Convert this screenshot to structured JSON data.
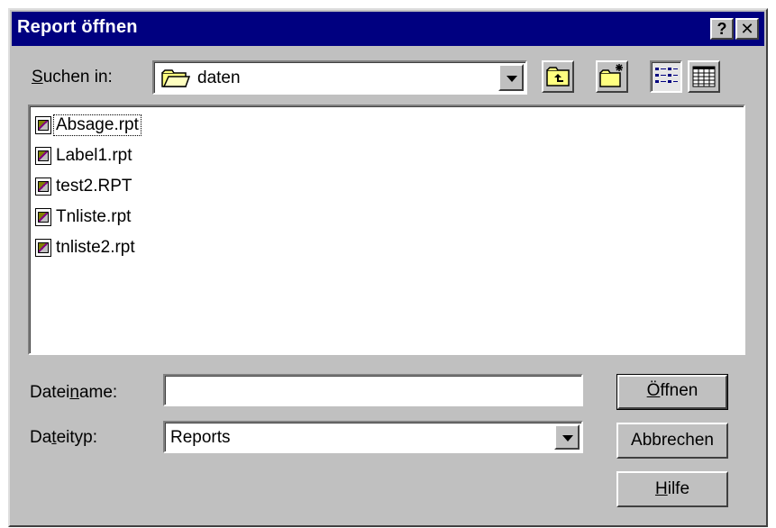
{
  "window": {
    "title": "Report öffnen",
    "help_button": "?",
    "close_button": "✕"
  },
  "lookin": {
    "label_pre": "",
    "label_key": "S",
    "label_post": "uchen in:",
    "value": "daten"
  },
  "toolbar": {
    "up_icon": "folder-up-icon",
    "new_folder_icon": "new-folder-icon",
    "list_icon": "list-view-icon",
    "details_icon": "details-view-icon"
  },
  "files": [
    {
      "name": "Absage.rpt"
    },
    {
      "name": "Label1.rpt"
    },
    {
      "name": "test2.RPT"
    },
    {
      "name": "Tnliste.rpt"
    },
    {
      "name": "tnliste2.rpt"
    }
  ],
  "filename": {
    "label_pre": "Datei",
    "label_key": "n",
    "label_post": "ame:",
    "value": ""
  },
  "filetype": {
    "label_pre": "Da",
    "label_key": "t",
    "label_post": "eityp:",
    "value": "Reports"
  },
  "buttons": {
    "open_key": "Ö",
    "open_post": "ffnen",
    "cancel": "Abbrechen",
    "help_key": "H",
    "help_post": "ilfe"
  },
  "colors": {
    "titlebar": "#000080",
    "face": "#c0c0c0"
  }
}
